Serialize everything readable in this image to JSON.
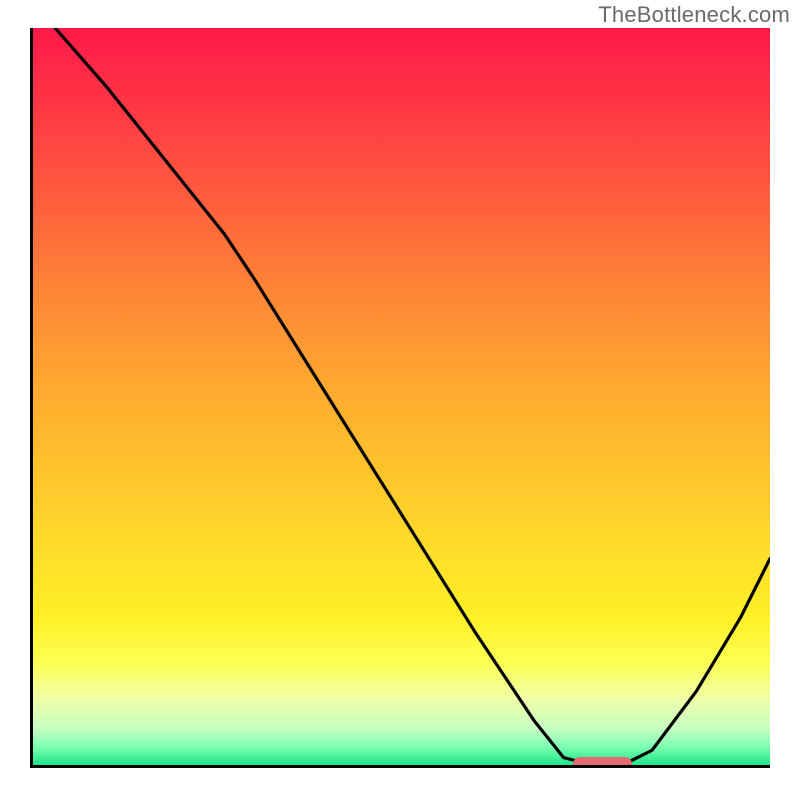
{
  "watermark": "TheBottleneck.com",
  "colors": {
    "gradient_top": "#ff1a49",
    "gradient_mid": "#ffc42c",
    "gradient_bottom": "#1fe588",
    "curve": "#000000",
    "marker": "#e36a6f"
  },
  "chart_data": {
    "type": "line",
    "title": "",
    "xlabel": "",
    "ylabel": "",
    "xlim": [
      0,
      100
    ],
    "ylim": [
      0,
      100
    ],
    "series": [
      {
        "name": "bottleneck_curve",
        "x": [
          3,
          10,
          18,
          26,
          30,
          40,
          50,
          60,
          68,
          72,
          76,
          80,
          84,
          90,
          96,
          100
        ],
        "y": [
          100,
          92,
          82,
          72,
          66,
          50,
          34,
          18,
          6,
          1,
          0,
          0,
          2,
          10,
          20,
          28
        ]
      }
    ],
    "marker": {
      "x_start": 73,
      "x_end": 81,
      "y": 0
    },
    "annotations": []
  }
}
